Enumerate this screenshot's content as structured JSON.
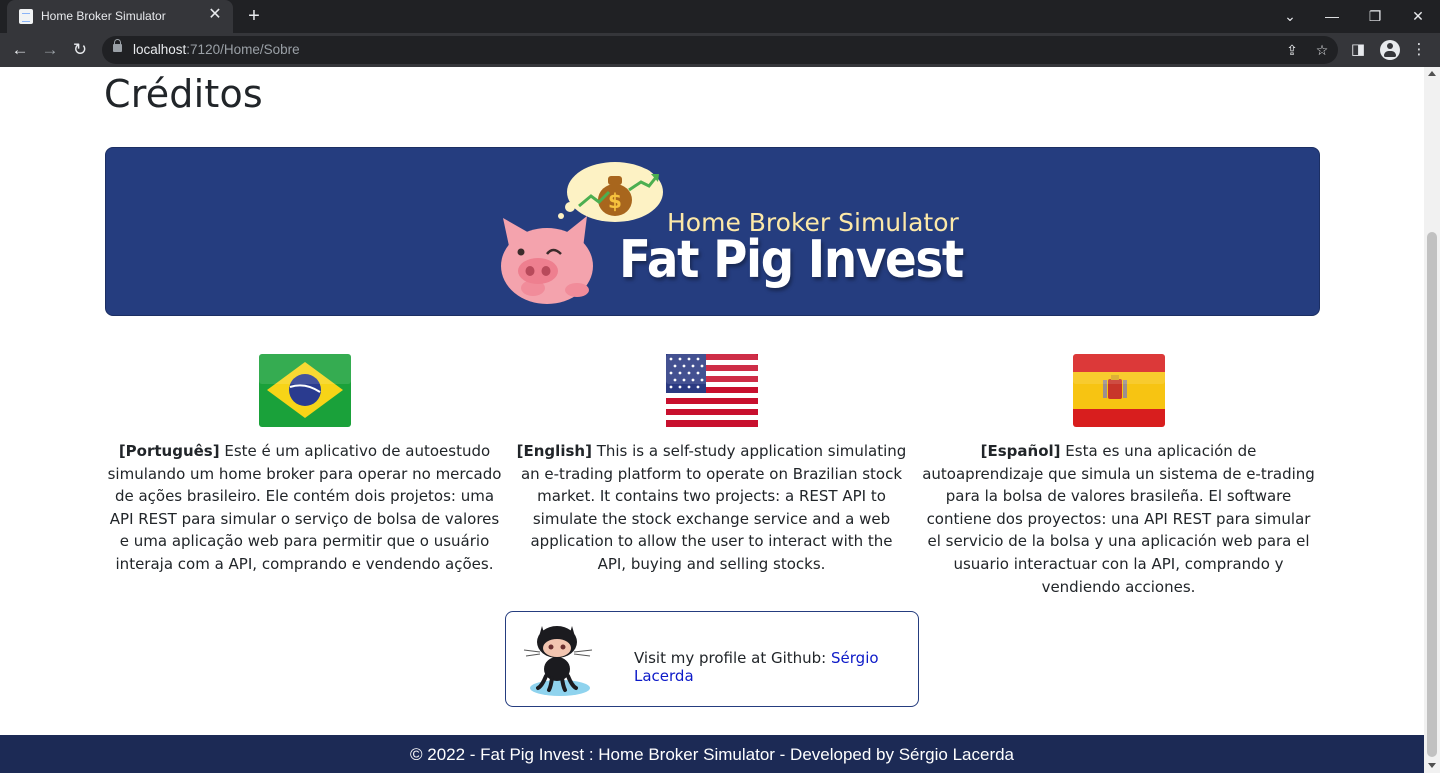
{
  "browser": {
    "tab_title": "Home Broker Simulator",
    "tab_close": "✕",
    "new_tab": "+",
    "url_host": "localhost",
    "url_path": ":7120/Home/Sobre",
    "icons": {
      "back": "back-arrow-icon",
      "forward": "forward-arrow-icon",
      "reload": "reload-icon",
      "share": "share-icon",
      "bookmark": "star-icon",
      "sidepanel": "side-panel-icon",
      "profile": "profile-icon",
      "menu": "kebab-menu-icon"
    }
  },
  "page": {
    "title": "Créditos",
    "banner": {
      "subtitle": "Home Broker Simulator",
      "title": "Fat Pig Invest"
    },
    "languages": [
      {
        "flag": "brazil-flag",
        "label": "[Português]",
        "text": " Este é um aplicativo de autoestudo simulando um home broker para operar no mercado de ações brasileiro. Ele contém dois projetos: uma API REST para simular o serviço de bolsa de valores e uma aplicação web para permitir que o usuário interaja com a API, comprando e vendendo ações."
      },
      {
        "flag": "usa-flag",
        "label": "[English]",
        "text": " This is a self-study application simulating an e-trading platform to operate on Brazilian stock market. It contains two projects: a REST API to simulate the stock exchange service and a web application to allow the user to interact with the API, buying and selling stocks."
      },
      {
        "flag": "spain-flag",
        "label": "[Español]",
        "text": " Esta es una aplicación de autoaprendizaje que simula un sistema de e-trading para la bolsa de valores brasileña. El software contiene dos proyectos: una API REST para simular el servicio de la bolsa y una aplicación web para el usuario interactuar con la API, comprando y vendiendo acciones."
      }
    ],
    "github": {
      "text": "Visit my profile at Github: ",
      "link_label": "Sérgio Lacerda"
    },
    "footer": "© 2022 - Fat Pig Invest : Home Broker Simulator - Developed by Sérgio Lacerda"
  },
  "colors": {
    "banner_bg": "#253d7f",
    "footer_bg": "#1c2a55",
    "link": "#0d1ac8",
    "pig": "#f4a3ad"
  }
}
